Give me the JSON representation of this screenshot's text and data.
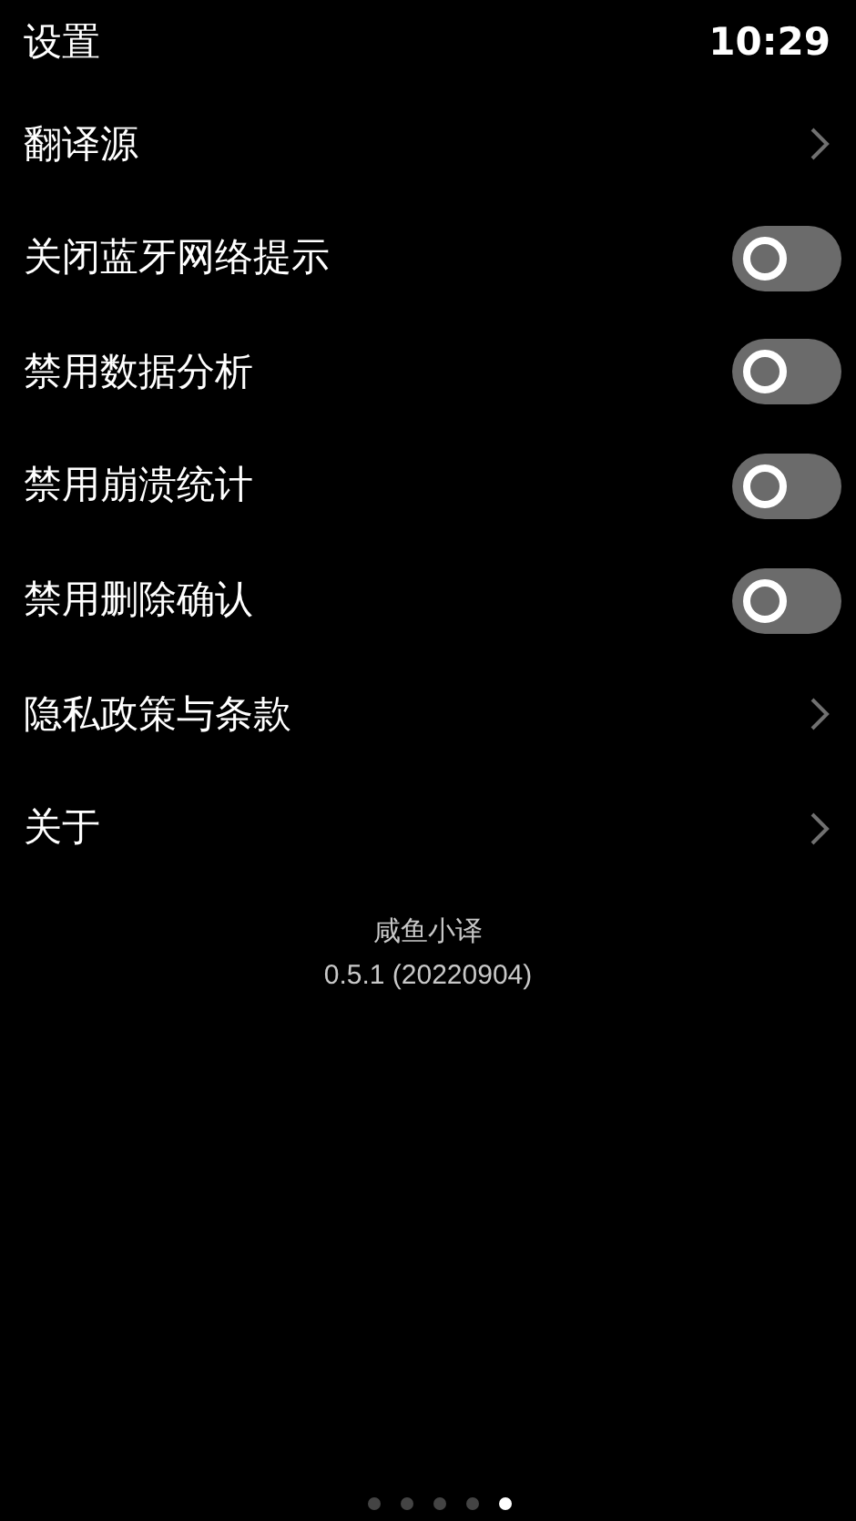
{
  "header": {
    "title": "设置",
    "time": "10:29"
  },
  "items": [
    {
      "kind": "link",
      "label": "翻译源"
    },
    {
      "kind": "toggle",
      "label": "关闭蓝牙网络提示",
      "on": false
    },
    {
      "kind": "toggle",
      "label": "禁用数据分析",
      "on": false
    },
    {
      "kind": "toggle",
      "label": "禁用崩溃统计",
      "on": false
    },
    {
      "kind": "toggle",
      "label": "禁用删除确认",
      "on": false
    },
    {
      "kind": "link",
      "label": "隐私政策与条款"
    },
    {
      "kind": "link",
      "label": "关于"
    }
  ],
  "app": {
    "name": "咸鱼小译",
    "version": "0.5.1 (20220904)"
  },
  "pages": [
    {
      "selected": false
    },
    {
      "selected": false
    },
    {
      "selected": false
    },
    {
      "selected": false
    },
    {
      "selected": true
    }
  ]
}
